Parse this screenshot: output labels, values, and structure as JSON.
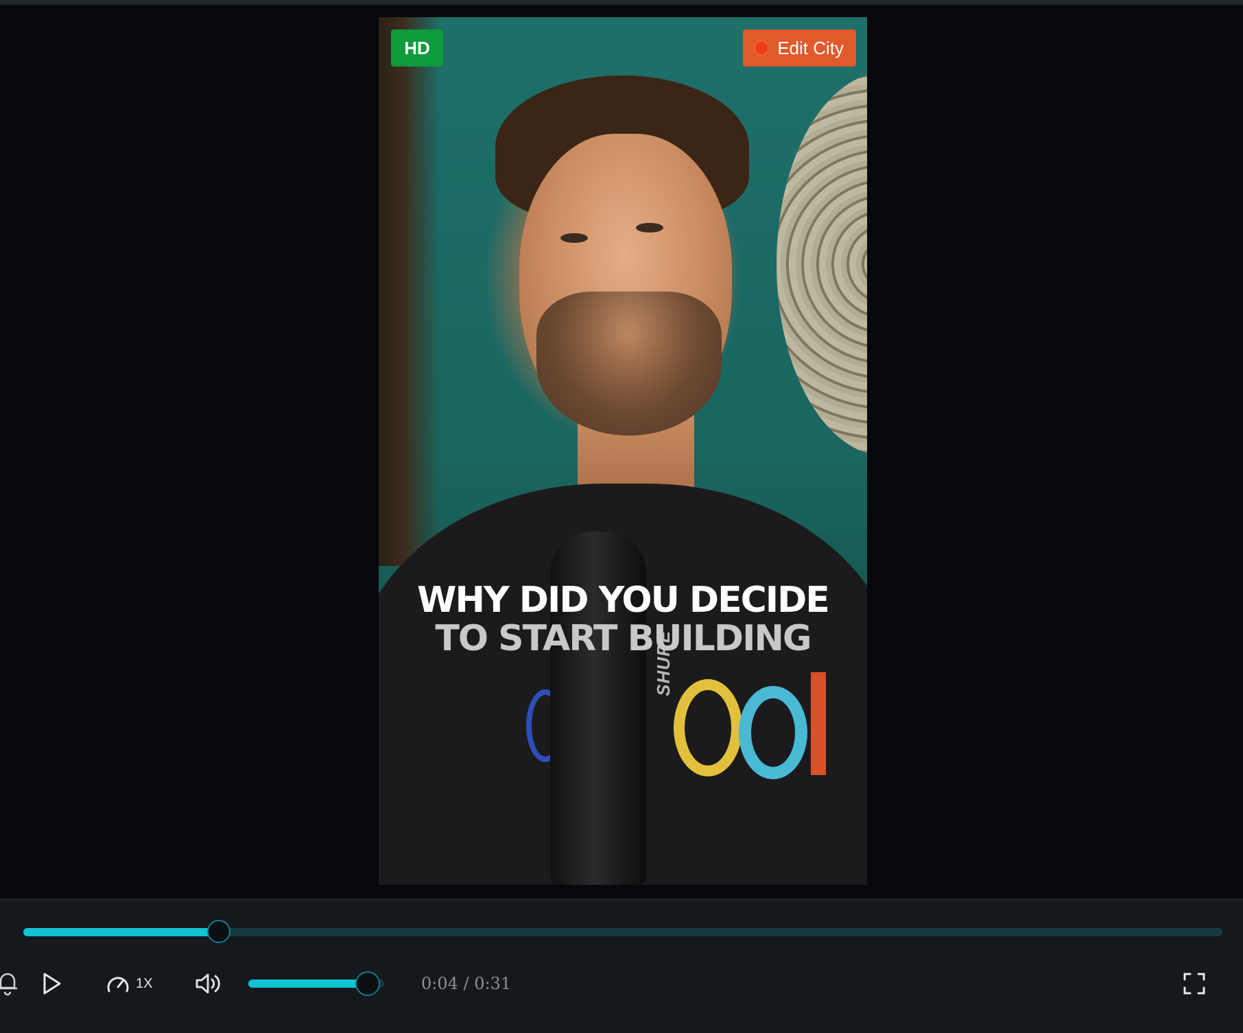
{
  "video": {
    "hd_badge": "HD",
    "edit_badge": "Edit City",
    "caption_line1": "WHY DID YOU DECIDE",
    "caption_line2": "TO START BUILDING",
    "mic_brand": "SHURE"
  },
  "player": {
    "progress_fraction": 0.163,
    "speed_label": "1X",
    "volume_fraction": 0.88,
    "current_time": "0:04",
    "separator": "/",
    "duration": "0:31"
  },
  "colors": {
    "accent": "#10c4d2",
    "hd_badge": "#0f9a3c",
    "edit_badge": "#e05a2a",
    "bar_background": "#15181c"
  },
  "icons": [
    "bell-icon",
    "play-icon",
    "speed-gauge-icon",
    "volume-icon",
    "fullscreen-icon"
  ]
}
